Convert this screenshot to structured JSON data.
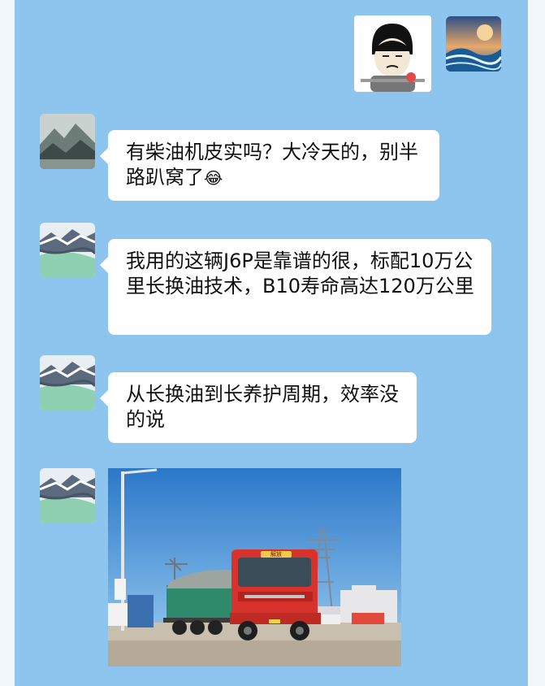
{
  "chat": {
    "messages": [
      {
        "text": "有柴油机皮实吗？大冷天的，别半路趴窝了",
        "emoji": "😂"
      },
      {
        "text": "我用的这辆J6P是靠谱的很，标配10万公里长换油技术，B10寿命高达120万公里"
      },
      {
        "text": "从长换油到长养护周期，效率没的说"
      }
    ],
    "truck_cab_text": "解放"
  },
  "colors": {
    "chat_background": "#8ec5ef",
    "bubble": "#ffffff",
    "truck_cab": "#d8322c",
    "cargo_cover": "#2e8a6a"
  },
  "icons": {
    "sticker": "meme-sticker",
    "self_avatar": "ocean-wave-avatar",
    "sender1_avatar": "misty-mountain-avatar",
    "sender2_avatar": "snowy-lake-avatar"
  }
}
